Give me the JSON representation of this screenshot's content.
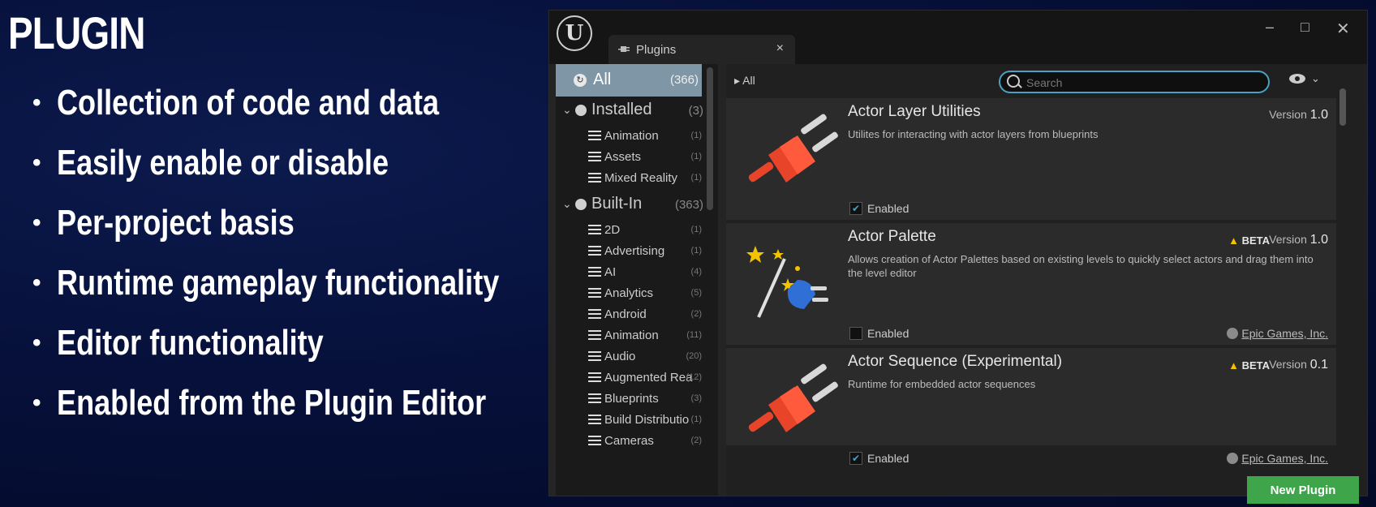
{
  "slide": {
    "title": "PLUGIN",
    "bullets": [
      "Collection of code and data",
      "Easily enable or disable",
      "Per-project basis",
      "Runtime gameplay functionality",
      "Editor functionality",
      "Enabled from the Plugin Editor"
    ]
  },
  "window": {
    "tab_label": "Plugins",
    "tab_close": "×",
    "logo_glyph": "U",
    "controls": {
      "minimize": "–",
      "maximize": "□",
      "close": "✕"
    }
  },
  "sidebar": {
    "all": {
      "label": "All",
      "count": "(366)"
    },
    "groups": [
      {
        "label": "Installed",
        "count": "(3)",
        "items": [
          {
            "label": "Animation",
            "count": "(1)"
          },
          {
            "label": "Assets",
            "count": "(1)"
          },
          {
            "label": "Mixed Reality",
            "count": "(1)"
          }
        ]
      },
      {
        "label": "Built-In",
        "count": "(363)",
        "items": [
          {
            "label": "2D",
            "count": "(1)"
          },
          {
            "label": "Advertising",
            "count": "(1)"
          },
          {
            "label": "AI",
            "count": "(4)"
          },
          {
            "label": "Analytics",
            "count": "(5)"
          },
          {
            "label": "Android",
            "count": "(2)"
          },
          {
            "label": "Animation",
            "count": "(11)"
          },
          {
            "label": "Audio",
            "count": "(20)"
          },
          {
            "label": "Augmented Rea",
            "count": "(12)"
          },
          {
            "label": "Blueprints",
            "count": "(3)"
          },
          {
            "label": "Build Distributio",
            "count": "(1)"
          },
          {
            "label": "Cameras",
            "count": "(2)"
          }
        ]
      }
    ]
  },
  "main": {
    "breadcrumb": "All",
    "search_placeholder": "Search",
    "plugins": [
      {
        "name": "Actor Layer Utilities",
        "description": "Utilites for interacting with actor layers from blueprints",
        "beta": "",
        "version_label": "Version",
        "version": "1.0",
        "enabled_label": "Enabled",
        "enabled": true,
        "author": "",
        "icon": "plug-icon"
      },
      {
        "name": "Actor Palette",
        "description": "Allows creation of Actor Palettes based on existing levels to quickly select actors and drag them into the level editor",
        "beta": "BETA",
        "version_label": "Version",
        "version": "1.0",
        "enabled_label": "Enabled",
        "enabled": false,
        "author": "Epic Games, Inc.",
        "icon": "magic-wand-plug-icon"
      },
      {
        "name": "Actor Sequence (Experimental)",
        "description": "Runtime for embedded actor sequences",
        "beta": "BETA",
        "version_label": "Version",
        "version": "0.1",
        "enabled_label": "Enabled",
        "enabled": true,
        "author": "Epic Games, Inc.",
        "icon": "plug-icon"
      }
    ],
    "new_plugin_label": "New Plugin"
  },
  "colors": {
    "slide_bg": "#06103a",
    "selected_category": "#7f96a6",
    "search_border": "#4aa1c4",
    "new_plugin_button": "#3ea54a",
    "beta_warning": "#f3c300",
    "plug_red": "#e8442a"
  }
}
